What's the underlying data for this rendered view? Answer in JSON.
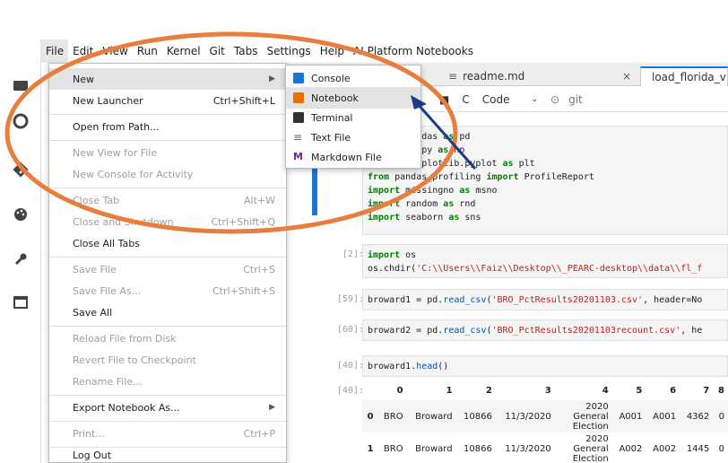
{
  "menubar": [
    "File",
    "Edit",
    "View",
    "Run",
    "Kernel",
    "Git",
    "Tabs",
    "Settings",
    "Help",
    "AI Platform Notebooks"
  ],
  "tabs": [
    {
      "label": "",
      "close": "×"
    },
    {
      "label": "readme.md",
      "close": "×"
    },
    {
      "label": "load_florida_v",
      "close": ""
    }
  ],
  "toolbar": {
    "run": "▶",
    "stop": "■",
    "restart": "C",
    "cell_type": "Code",
    "git": "git"
  },
  "file_menu": [
    {
      "label": "New",
      "shortcut": "",
      "submenu": true,
      "disabled": false,
      "highlighted": true
    },
    {
      "label": "New Launcher",
      "shortcut": "Ctrl+Shift+L",
      "disabled": false
    },
    {
      "label": "Open from Path...",
      "shortcut": "",
      "disabled": false
    },
    {
      "label": "New View for File",
      "shortcut": "",
      "disabled": true
    },
    {
      "label": "New Console for Activity",
      "shortcut": "",
      "disabled": true
    },
    {
      "label": "Close Tab",
      "shortcut": "Alt+W",
      "disabled": true
    },
    {
      "label": "Close and Shutdown",
      "shortcut": "Ctrl+Shift+Q",
      "disabled": true
    },
    {
      "label": "Close All Tabs",
      "shortcut": "",
      "disabled": false
    },
    {
      "label": "Save File",
      "shortcut": "Ctrl+S",
      "disabled": true
    },
    {
      "label": "Save File As...",
      "shortcut": "Ctrl+Shift+S",
      "disabled": true
    },
    {
      "label": "Save All",
      "shortcut": "",
      "disabled": false
    },
    {
      "label": "Reload File from Disk",
      "shortcut": "",
      "disabled": true
    },
    {
      "label": "Revert File to Checkpoint",
      "shortcut": "",
      "disabled": true
    },
    {
      "label": "Rename File...",
      "shortcut": "",
      "disabled": true
    },
    {
      "label": "Export Notebook As...",
      "shortcut": "",
      "submenu": true,
      "disabled": false
    },
    {
      "label": "Print...",
      "shortcut": "Ctrl+P",
      "disabled": true
    },
    {
      "label": "Log Out",
      "shortcut": "",
      "disabled": false
    }
  ],
  "new_submenu": [
    {
      "label": "Console",
      "icon": "console-icon",
      "color": "#1976d2"
    },
    {
      "label": "Notebook",
      "icon": "notebook-icon",
      "color": "#ef6c00"
    },
    {
      "label": "Terminal",
      "icon": "terminal-icon",
      "color": "#333333"
    },
    {
      "label": "Text File",
      "icon": "text-file-icon",
      "color": "#616161"
    },
    {
      "label": "Markdown File",
      "icon": "markdown-icon",
      "color": "#7b1fa2"
    }
  ],
  "cells": [
    {
      "prompt": "",
      "lines": [
        "import pandas as pd",
        "import numpy as np",
        "import matplotlib.pyplot as plt",
        "from pandas_profiling import ProfileReport",
        "import missingno as msno",
        "import random as rnd",
        "import seaborn as sns"
      ]
    },
    {
      "prompt": "[2]:",
      "lines": [
        "import os",
        "os.chdir('C:\\\\Users\\\\Faiz\\\\Desktop\\\\_PEARC-desktop\\\\data\\\\fl_f"
      ]
    },
    {
      "prompt": "[59]:",
      "lines": [
        "broward1 = pd.read_csv('BRO_PctResults20201103.csv', header=No"
      ]
    },
    {
      "prompt": "[60]:",
      "lines": [
        "broward2 = pd.read_csv('BRO_PctResults20201103recount.csv', he"
      ]
    },
    {
      "prompt": "[40]:",
      "lines": [
        "broward1.head()"
      ]
    }
  ],
  "output_prompt": "[40]:",
  "df": {
    "columns": [
      "",
      "0",
      "1",
      "2",
      "3",
      "4",
      "5",
      "6",
      "7",
      "8"
    ],
    "rows": [
      [
        "0",
        "BRO",
        "Broward",
        "10866",
        "11/3/2020",
        "2020 General Election",
        "A001",
        "A001",
        "4362",
        "0"
      ],
      [
        "1",
        "BRO",
        "Broward",
        "10866",
        "11/3/2020",
        "2020 General Election",
        "A002",
        "A002",
        "1445",
        "0"
      ]
    ]
  },
  "annotation_colors": {
    "ellipse": "#e87d3e",
    "arrow": "#1a3a8a"
  }
}
